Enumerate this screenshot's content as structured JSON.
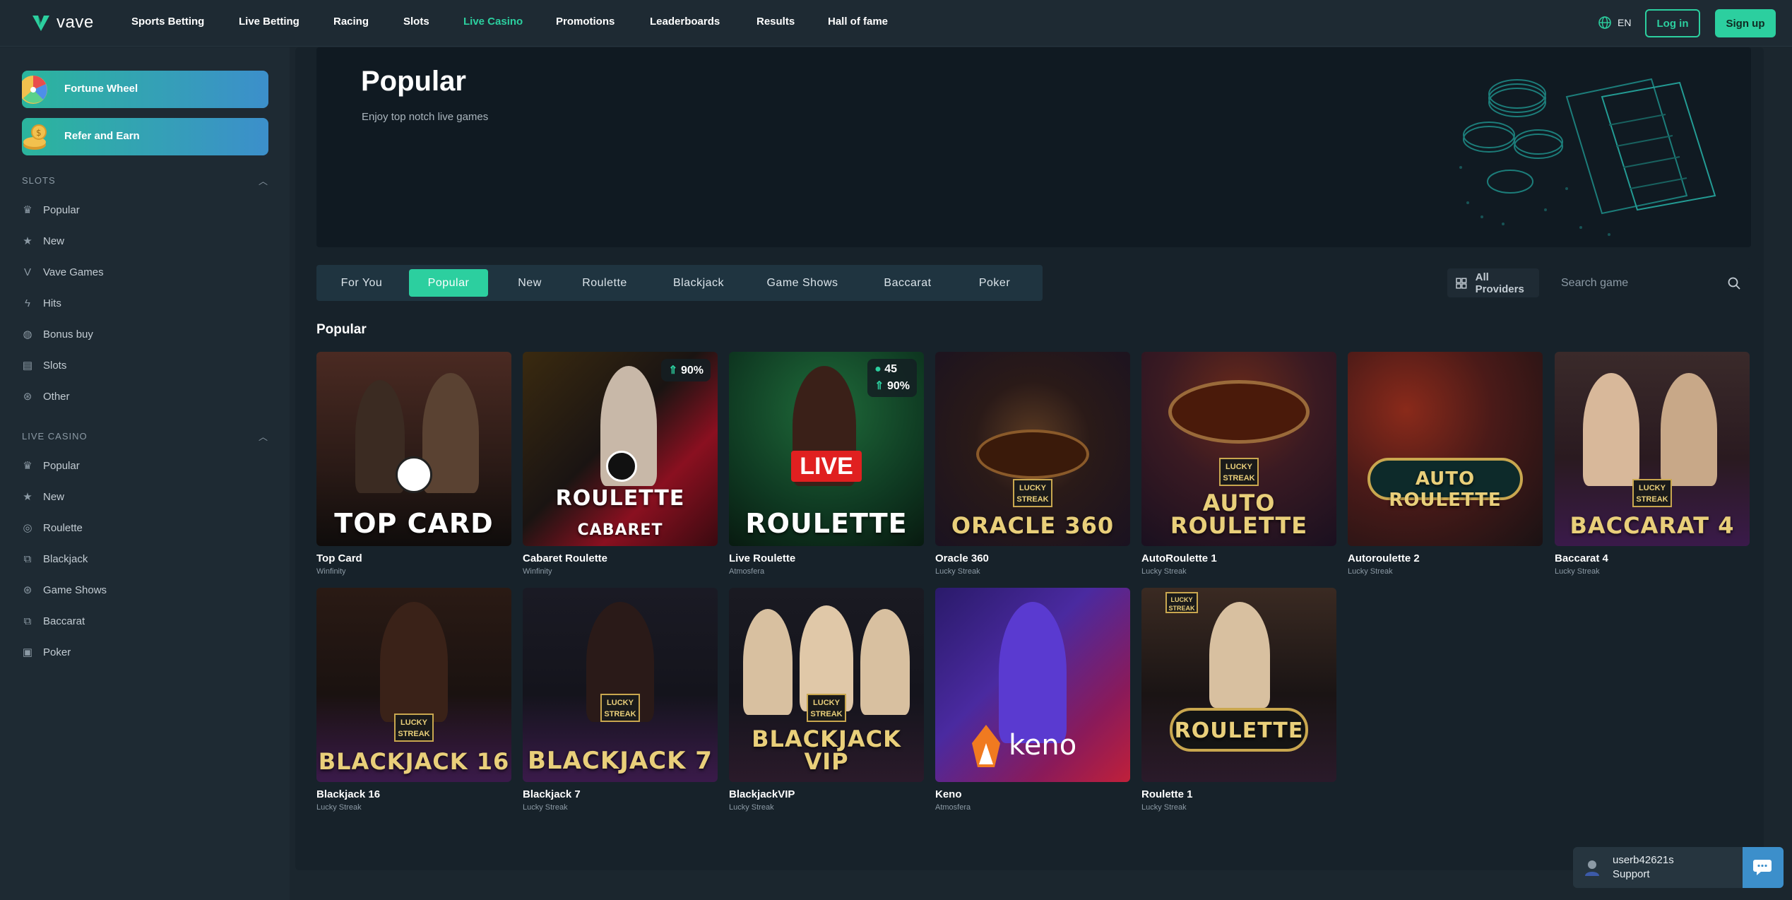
{
  "brand": {
    "name": "vave",
    "accent": "#2ccf9f"
  },
  "nav": {
    "links": [
      "Sports Betting",
      "Live Betting",
      "Racing",
      "Slots",
      "Live Casino",
      "Promotions",
      "Leaderboards",
      "Results",
      "Hall of fame"
    ],
    "active": "Live Casino",
    "language": "EN",
    "login_label": "Log in",
    "signup_label": "Sign up"
  },
  "sidebar": {
    "promos": [
      {
        "label": "Fortune Wheel",
        "icon": "fortune-wheel-icon"
      },
      {
        "label": "Refer and Earn",
        "icon": "coins-icon"
      }
    ],
    "sections": [
      {
        "title": "SLOTS",
        "items": [
          {
            "label": "Popular",
            "icon": "crown-icon"
          },
          {
            "label": "New",
            "icon": "star-icon"
          },
          {
            "label": "Vave Games",
            "icon": "vave-icon"
          },
          {
            "label": "Hits",
            "icon": "lightning-icon"
          },
          {
            "label": "Bonus buy",
            "icon": "moneybag-icon"
          },
          {
            "label": "Slots",
            "icon": "slot-machine-icon"
          },
          {
            "label": "Other",
            "icon": "chip-icon"
          }
        ]
      },
      {
        "title": "LIVE CASINO",
        "items": [
          {
            "label": "Popular",
            "icon": "crown-icon"
          },
          {
            "label": "New",
            "icon": "star-icon"
          },
          {
            "label": "Roulette",
            "icon": "roulette-icon"
          },
          {
            "label": "Blackjack",
            "icon": "cards-icon"
          },
          {
            "label": "Game Shows",
            "icon": "chip-icon"
          },
          {
            "label": "Baccarat",
            "icon": "cards-icon"
          },
          {
            "label": "Poker",
            "icon": "card-icon"
          }
        ]
      }
    ]
  },
  "hero": {
    "title": "Popular",
    "subtitle": "Enjoy top notch live games"
  },
  "tabs": [
    "For You",
    "Popular",
    "New",
    "Roulette",
    "Blackjack",
    "Game Shows",
    "Baccarat",
    "Poker"
  ],
  "active_tab": "Popular",
  "providers_label": "All Providers",
  "search": {
    "placeholder": "Search game"
  },
  "section_title": "Popular",
  "games": [
    {
      "name": "Top Card",
      "provider": "Winfinity",
      "art": "TOP CARD"
    },
    {
      "name": "Cabaret Roulette",
      "provider": "Winfinity",
      "art": "ROULETTE",
      "art2": "CABARET",
      "rtp": "90%"
    },
    {
      "name": "Live Roulette",
      "provider": "Atmosfera",
      "art": "ROULETTE",
      "art_top": "LIVE",
      "players": "45",
      "rtp": "90%"
    },
    {
      "name": "Oracle 360",
      "provider": "Lucky Streak",
      "art": "ORACLE 360",
      "streak": "LUCKY STREAK"
    },
    {
      "name": "AutoRoulette 1",
      "provider": "Lucky Streak",
      "art": "AUTO",
      "art2": "ROULETTE",
      "streak": "LUCKY STREAK"
    },
    {
      "name": "Autoroulette 2",
      "provider": "Lucky Streak",
      "art": "AUTO",
      "art2": "ROULETTE"
    },
    {
      "name": "Baccarat 4",
      "provider": "Lucky Streak",
      "art": "BACCARAT 4",
      "streak": "LUCKY STREAK"
    },
    {
      "name": "Blackjack 16",
      "provider": "Lucky Streak",
      "art": "BLACKJACK 16",
      "streak": "LUCKY STREAK"
    },
    {
      "name": "Blackjack 7",
      "provider": "Lucky Streak",
      "art": "BLACKJACK 7",
      "streak": "LUCKY STREAK"
    },
    {
      "name": "BlackjackVIP",
      "provider": "Lucky Streak",
      "art": "BLACKJACK",
      "art2": "VIP",
      "streak": "LUCKY STREAK"
    },
    {
      "name": "Keno",
      "provider": "Atmosfera",
      "art": "keno"
    },
    {
      "name": "Roulette 1",
      "provider": "Lucky Streak",
      "art": "ROULETTE",
      "streak": "LUCKY STREAK"
    }
  ],
  "support": {
    "username": "userb42621s",
    "label": "Support"
  }
}
